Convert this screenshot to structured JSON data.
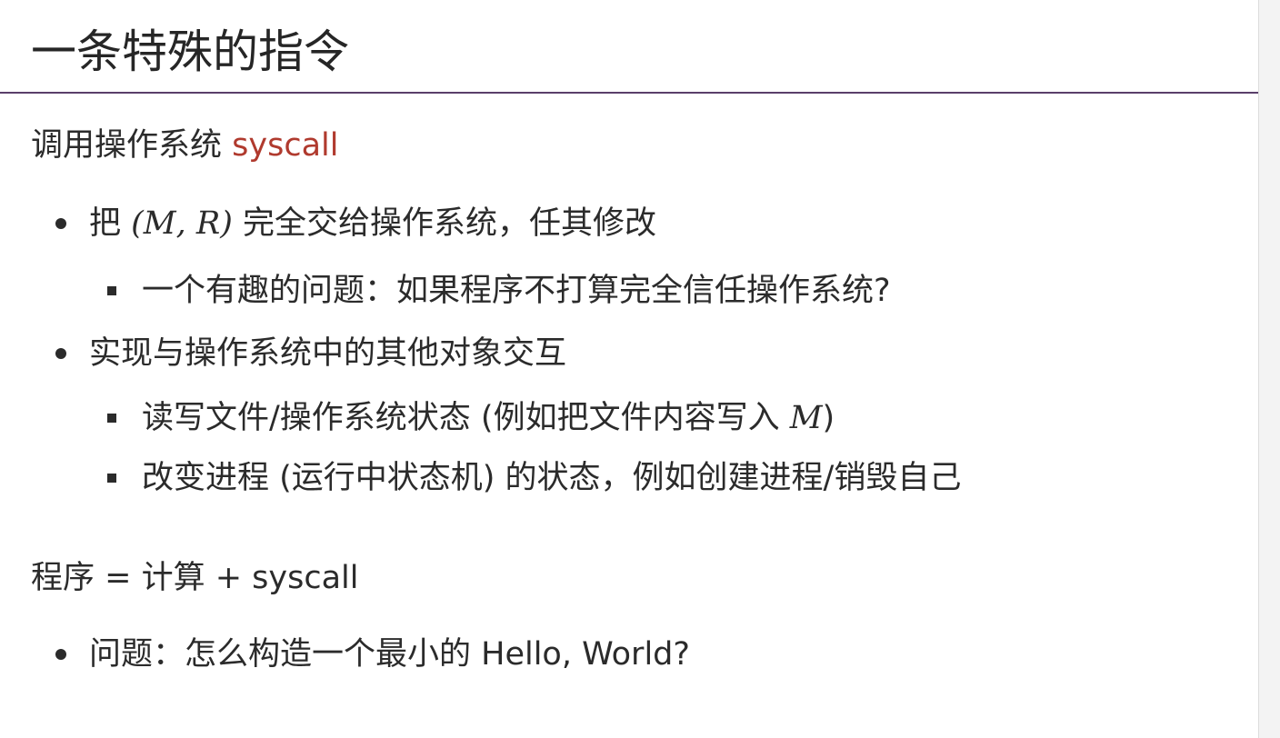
{
  "title": "一条特殊的指令",
  "section1": {
    "lead_prefix": "调用操作系统 ",
    "lead_keyword": "syscall",
    "bullets": [
      {
        "prefix": "把 ",
        "math": "(M, R)",
        "suffix": " 完全交给操作系统，任其修改",
        "sub": [
          "一个有趣的问题：如果程序不打算完全信任操作系统?"
        ]
      },
      {
        "text": "实现与操作系统中的其他对象交互",
        "sub": [
          {
            "prefix": "读写文件/操作系统状态 (例如把文件内容写入 ",
            "math": "M",
            "suffix": ")"
          },
          "改变进程 (运行中状态机) 的状态，例如创建进程/销毁自己"
        ]
      }
    ]
  },
  "section2": {
    "lead": "程序 = 计算 + syscall",
    "bullets": [
      "问题：怎么构造一个最小的 Hello, World?"
    ]
  },
  "colors": {
    "accent": "#b03a2e",
    "title_rule": "#5a3f6a",
    "text": "#2b2b2b"
  }
}
